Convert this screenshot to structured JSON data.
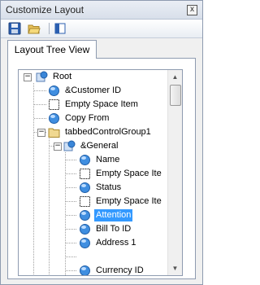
{
  "window": {
    "title": "Customize Layout",
    "close_glyph": "x"
  },
  "toolbar": {
    "buttons": [
      {
        "name": "save-icon"
      },
      {
        "name": "open-folder-icon"
      },
      {
        "name": "restore-layout-icon"
      }
    ]
  },
  "tab": {
    "label": "Layout Tree View"
  },
  "tree": {
    "nodes": [
      {
        "label": "Root",
        "icon": "root-icon",
        "expanded": true
      },
      {
        "label": "&Customer ID",
        "icon": "item-icon"
      },
      {
        "label": "Empty Space Item",
        "icon": "empty-space-icon"
      },
      {
        "label": "Copy From",
        "icon": "item-icon"
      },
      {
        "label": "tabbedControlGroup1",
        "icon": "tabbed-group-icon",
        "expanded": true
      },
      {
        "label": "&General",
        "icon": "group-icon",
        "expanded": true
      },
      {
        "label": "Name",
        "icon": "item-icon"
      },
      {
        "label": "Empty Space Ite",
        "icon": "empty-space-icon"
      },
      {
        "label": "Status",
        "icon": "item-icon"
      },
      {
        "label": "Empty Space Ite",
        "icon": "empty-space-icon"
      },
      {
        "label": "Attention",
        "icon": "item-icon",
        "selected": true
      },
      {
        "label": "Bill To ID",
        "icon": "item-icon"
      },
      {
        "label": "Address 1",
        "icon": "item-icon"
      },
      {
        "label": "Currency ID",
        "icon": "item-icon"
      }
    ]
  },
  "colors": {
    "selection": "#3399ff",
    "border": "#8e9bb0",
    "item_blue": "#2f7fd8"
  }
}
